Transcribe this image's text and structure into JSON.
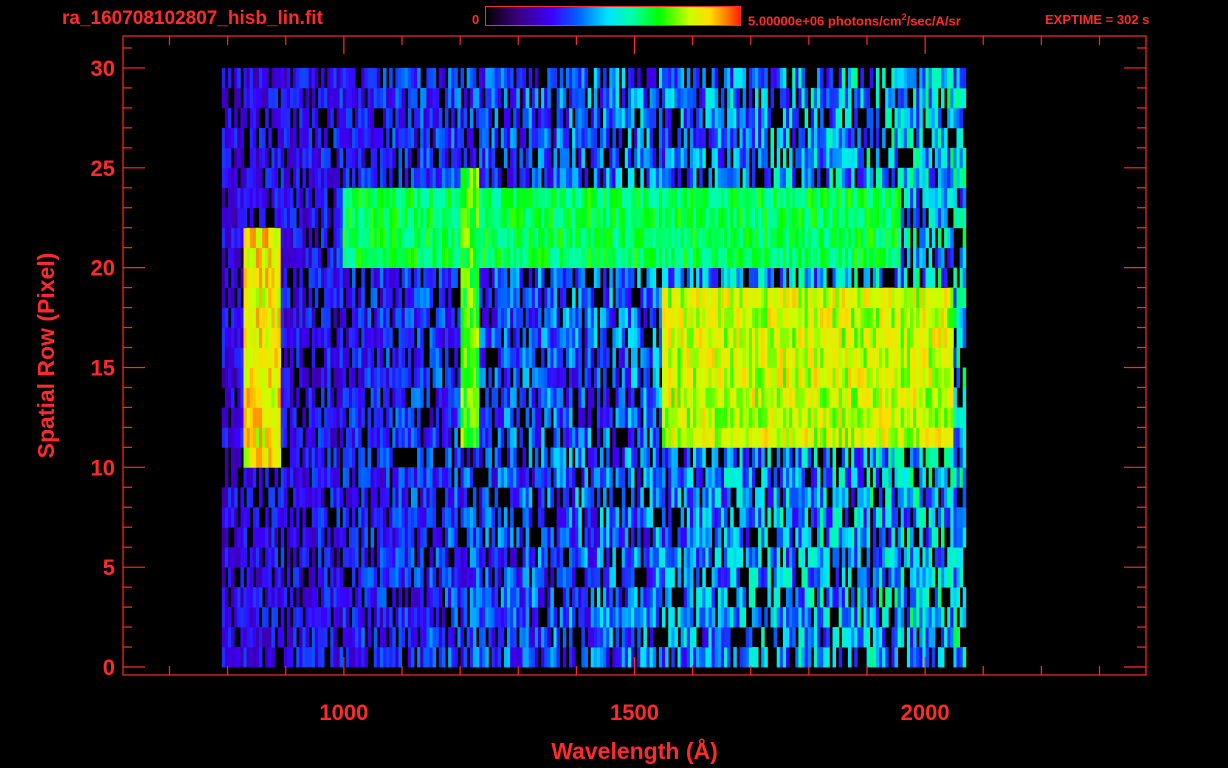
{
  "header": {
    "file_name": "ra_160708102807_hisb_lin.fit",
    "colorbar_min": "0",
    "colorbar_max_prefix": "5.00000e+06 photons/cm",
    "colorbar_max_sup": "2",
    "colorbar_max_suffix": "/sec/A/sr",
    "exptime": "EXPTIME = 302 s"
  },
  "colors": {
    "axis": "#ff2a2a",
    "background": "#000000"
  },
  "chart_data": {
    "type": "heatmap",
    "xlabel": "Wavelength (Å)",
    "ylabel": "Spatial Row (Pixel)",
    "xlim": [
      620,
      2380
    ],
    "ylim": [
      -0.4,
      31.6
    ],
    "x_ticks": [
      1000,
      1500,
      2000
    ],
    "x_tick_labels": [
      "1000",
      "1500",
      "2000"
    ],
    "y_ticks": [
      0,
      5,
      10,
      15,
      20,
      25,
      30
    ],
    "y_tick_labels": [
      "0",
      "5",
      "10",
      "15",
      "20",
      "25",
      "30"
    ],
    "data_x_range": [
      790,
      2070
    ],
    "rows": 30,
    "colorbar_range": [
      0,
      5000000
    ],
    "colormap": [
      "#000000",
      "#3a007a",
      "#3c00ff",
      "#0060ff",
      "#00e5ff",
      "#00ffa0",
      "#00ff00",
      "#c8ff00",
      "#ffdd00",
      "#ff7800",
      "#ff2000"
    ],
    "features": [
      {
        "x_start": 830,
        "x_end": 890,
        "row_start": 10,
        "row_end": 21,
        "intensity": 0.78
      },
      {
        "x_start": 1200,
        "x_end": 1230,
        "row_start": 11,
        "row_end": 24,
        "intensity": 0.62
      },
      {
        "x_start": 1000,
        "x_end": 1960,
        "row_start": 20,
        "row_end": 23,
        "intensity": 0.55
      },
      {
        "x_start": 1550,
        "x_end": 2050,
        "row_start": 11,
        "row_end": 18,
        "intensity": 0.72
      }
    ]
  }
}
